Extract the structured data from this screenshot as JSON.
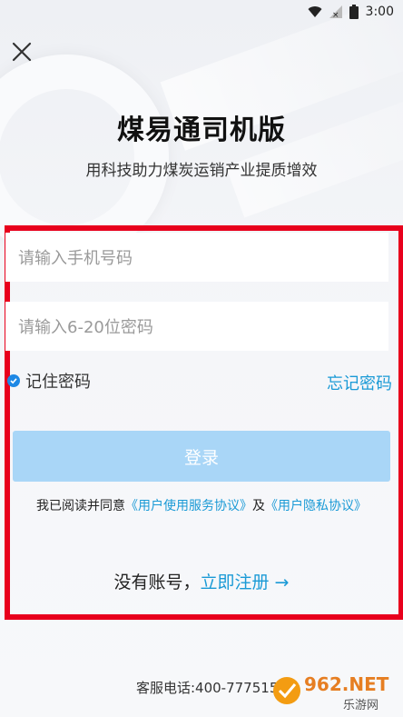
{
  "status_bar": {
    "time": "3:00"
  },
  "header": {
    "title": "煤易通司机版",
    "subtitle": "用科技助力煤炭运销产业提质增效"
  },
  "form": {
    "phone_placeholder": "请输入手机号码",
    "password_placeholder": "请输入6-20位密码",
    "remember_label": "记住密码",
    "forgot_label": "忘记密码",
    "login_label": "登录",
    "agreement_prefix": "我已阅读并同意",
    "agreement_user": "《用户使用服务协议》",
    "agreement_and": "及",
    "agreement_privacy": "《用户隐私协议》",
    "no_account": "没有账号，",
    "register_label": "立即注册 →"
  },
  "footer": {
    "service_phone": "客服电话:400-7775151"
  },
  "watermark": {
    "brand": "962.NET",
    "sub": "乐游网"
  },
  "colors": {
    "accent": "#1a9ad6",
    "button": "#a9d6f7",
    "frame": "#e8001c"
  }
}
